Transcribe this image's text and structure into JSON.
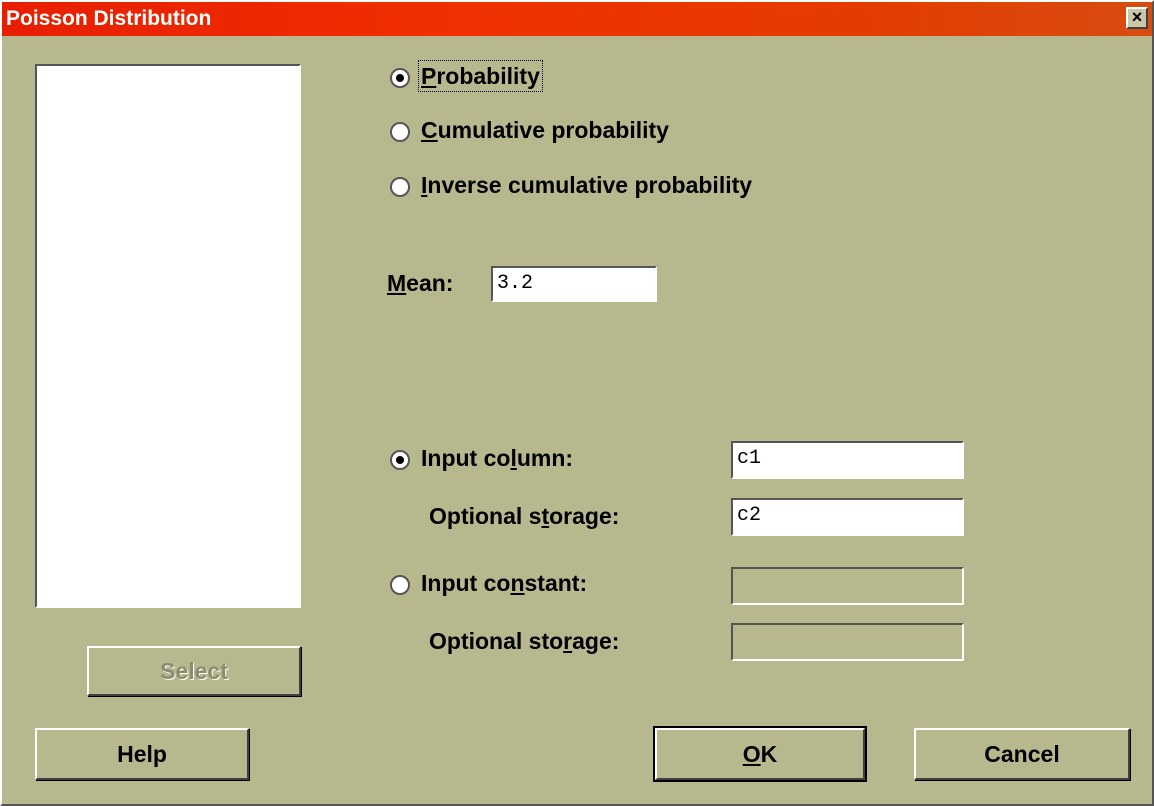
{
  "window": {
    "title": "Poisson Distribution",
    "close_glyph": "×"
  },
  "variables_list": {
    "items": []
  },
  "select_button": {
    "label": "Select",
    "enabled": false
  },
  "mode": {
    "selected": "probability",
    "options": [
      {
        "id": "probability",
        "pre": "",
        "key": "P",
        "post": "robability"
      },
      {
        "id": "cumulative",
        "pre": "",
        "key": "C",
        "post": "umulative probability"
      },
      {
        "id": "inverse",
        "pre": "",
        "key": "I",
        "post": "nverse cumulative probability"
      }
    ]
  },
  "mean": {
    "pre": "",
    "key": "M",
    "post": "ean:",
    "value": "3.2"
  },
  "input_source": {
    "selected": "column",
    "column": {
      "pre": "Input co",
      "key": "l",
      "post": "umn:",
      "value": "c1",
      "storage_pre": "Optional s",
      "storage_key": "t",
      "storage_post": "orage:",
      "storage_value": "c2"
    },
    "constant": {
      "pre": "Input co",
      "key": "n",
      "post": "stant:",
      "value": "",
      "storage_pre": "Optional sto",
      "storage_key": "r",
      "storage_post": "age:",
      "storage_value": ""
    }
  },
  "buttons": {
    "help": "Help",
    "ok_key": "O",
    "ok_post": "K",
    "cancel": "Cancel"
  }
}
